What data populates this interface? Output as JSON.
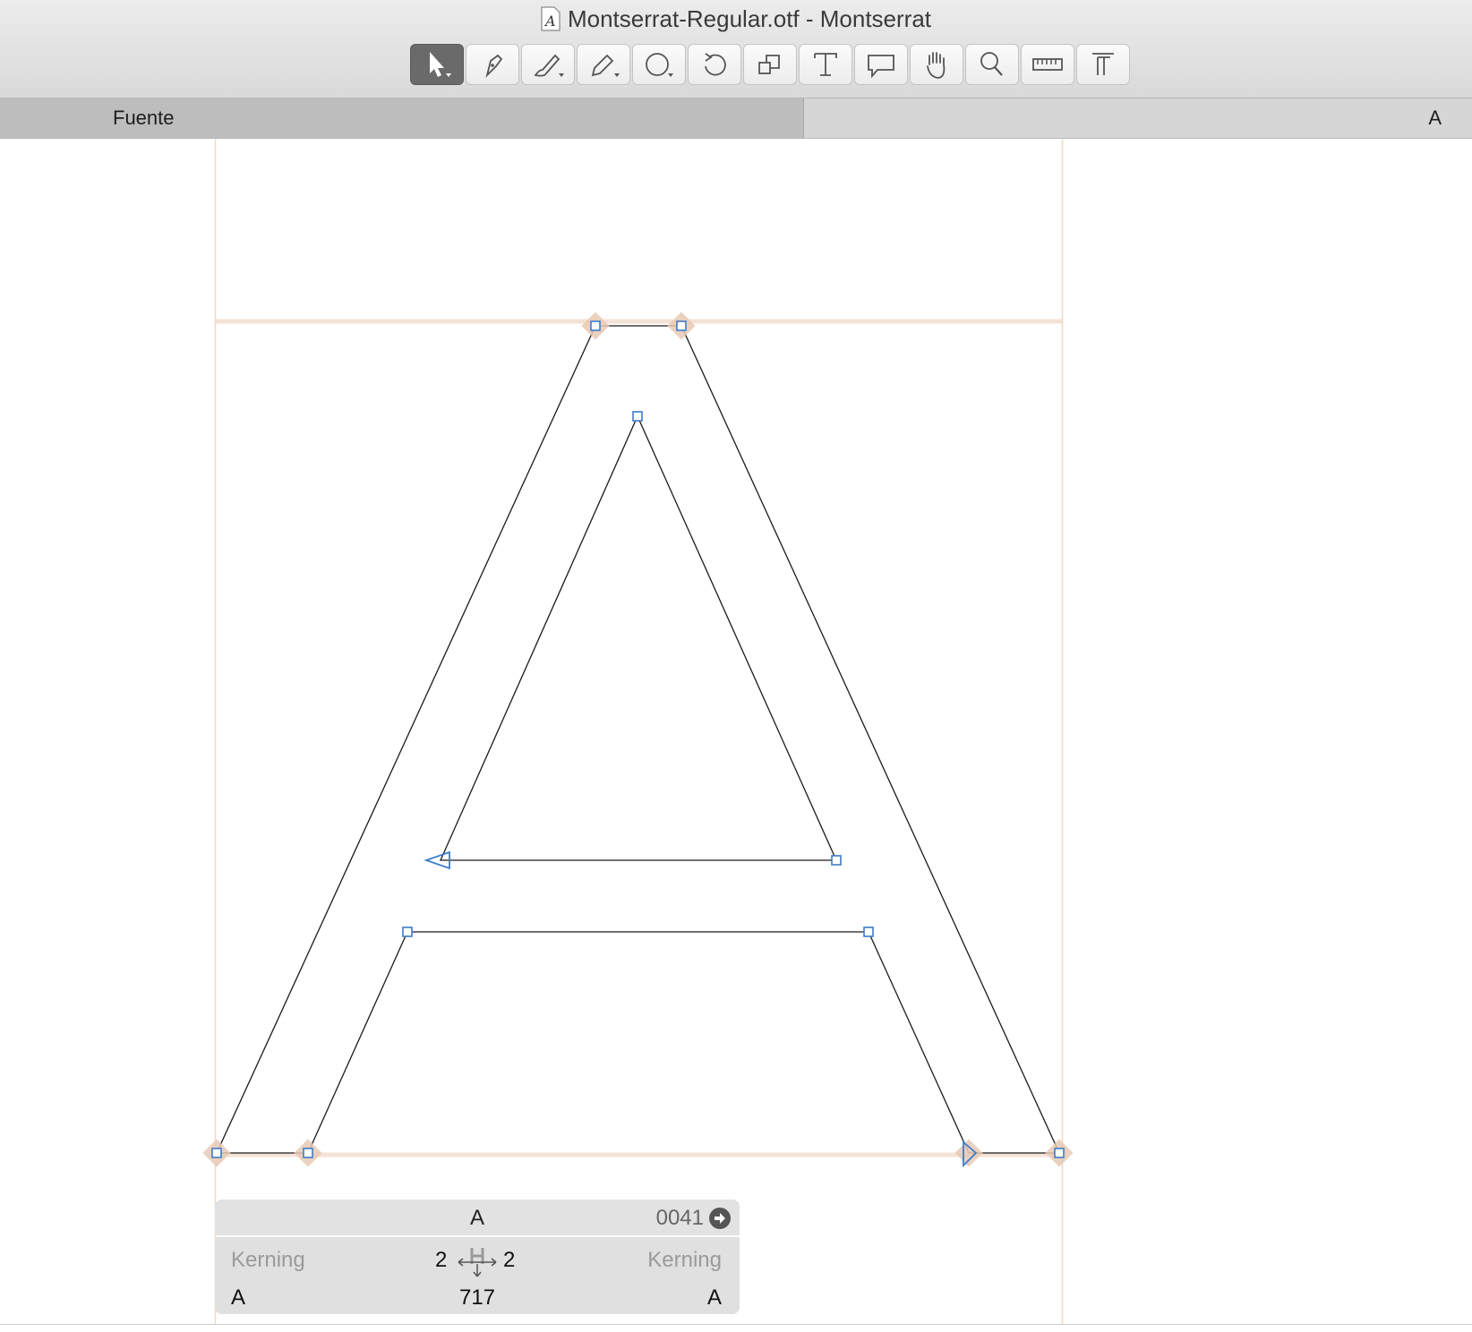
{
  "window": {
    "title": "Montserrat-Regular.otf - Montserrat"
  },
  "toolbar": {
    "tools": [
      {
        "name": "pointer-tool-button",
        "icon": "pointer-icon",
        "active": true
      },
      {
        "name": "pen-tool-button",
        "icon": "pen-icon"
      },
      {
        "name": "brush-tool-button",
        "icon": "brush-icon"
      },
      {
        "name": "pencil-tool-button",
        "icon": "pencil-icon"
      },
      {
        "name": "shape-tool-button",
        "icon": "circle-icon"
      },
      {
        "name": "rotate-tool-button",
        "icon": "rotate-icon"
      },
      {
        "name": "scale-tool-button",
        "icon": "scale-icon"
      },
      {
        "name": "text-tool-button",
        "icon": "text-icon"
      },
      {
        "name": "annotation-tool-button",
        "icon": "speech-bubble-icon"
      },
      {
        "name": "hand-tool-button",
        "icon": "hand-icon"
      },
      {
        "name": "zoom-tool-button",
        "icon": "magnifier-icon"
      },
      {
        "name": "measure-tool-button",
        "icon": "ruler-icon"
      },
      {
        "name": "metrics-tool-button",
        "icon": "metrics-icon"
      }
    ]
  },
  "tabs": {
    "font_tab": "Fuente",
    "glyph_tab": "A"
  },
  "colors": {
    "outline": "#1a1a1a",
    "node": "#3d7cc9",
    "guide": "#f1d7c7",
    "diamond": "#e8c9b4"
  },
  "info": {
    "glyph": "A",
    "unicode": "0041",
    "kerning_left_label": "Kerning",
    "kerning_right_label": "Kerning",
    "lsb": "2",
    "rsb": "2",
    "left_glyph": "A",
    "right_glyph": "A",
    "advance": "717"
  }
}
